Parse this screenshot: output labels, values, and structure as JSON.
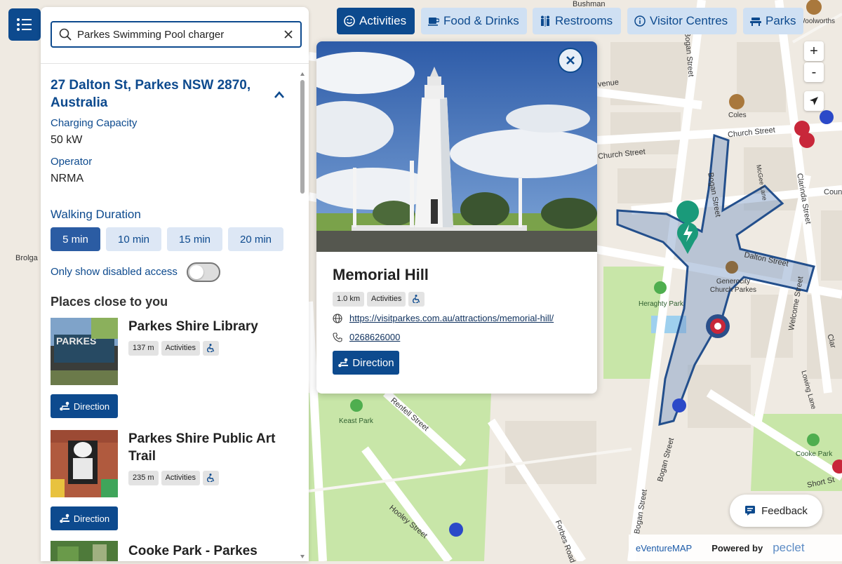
{
  "search": {
    "value": "Parkes Swimming Pool charger"
  },
  "charger": {
    "address": "27 Dalton St, Parkes NSW 2870, Australia",
    "capacity_label": "Charging Capacity",
    "capacity_value": "50 kW",
    "operator_label": "Operator",
    "operator_value": "NRMA"
  },
  "walking": {
    "label": "Walking Duration",
    "options": [
      "5 min",
      "10 min",
      "15 min",
      "20 min"
    ],
    "selected": "5 min",
    "disabled_toggle_label": "Only show disabled access",
    "disabled_toggle_on": false
  },
  "places": {
    "heading": "Places close to you",
    "items": [
      {
        "title": "Parkes Shire Library",
        "distance": "137 m",
        "category": "Activities",
        "direction": "Direction"
      },
      {
        "title": "Parkes Shire Public Art Trail",
        "distance": "235 m",
        "category": "Activities",
        "direction": "Direction"
      },
      {
        "title": "Cooke Park - Parkes",
        "distance": "",
        "category": "",
        "direction": ""
      }
    ]
  },
  "categories": [
    {
      "label": "Activities",
      "active": true,
      "icon": "smile-icon"
    },
    {
      "label": "Food & Drinks",
      "active": false,
      "icon": "cup-icon"
    },
    {
      "label": "Restrooms",
      "active": false,
      "icon": "restroom-icon"
    },
    {
      "label": "Visitor Centres",
      "active": false,
      "icon": "info-icon"
    },
    {
      "label": "Parks",
      "active": false,
      "icon": "bench-icon"
    }
  ],
  "popup": {
    "title": "Memorial Hill",
    "distance": "1.0 km",
    "category": "Activities",
    "url": "https://visitparkes.com.au/attractions/memorial-hill/",
    "phone": "0268626000",
    "direction": "Direction"
  },
  "map": {
    "streets": [
      "Bushman",
      "Bogan Street",
      "Church Street",
      "Church Street",
      "McGee Lane",
      "Clarinda Street",
      "Dalton Street",
      "Welcome Street",
      "Lowing Lane",
      "Hooley Street",
      "Forbes Road",
      "Renfell Street",
      "Brolga",
      "Short St",
      "venue",
      "Coun",
      "Clar",
      "Woolworths",
      "Coles",
      "Generocity Church Parkes",
      "Heraghty Park",
      "Keast Park",
      "Cooke Park",
      "Bogan Street",
      "Bogan Street",
      "Bogan Street"
    ],
    "zoom_in": "+",
    "zoom_out": "-",
    "feedback": "Feedback",
    "powered_by": "Powered by",
    "brand_eventure": "eVentureMAP",
    "brand_peclet": "peclet"
  }
}
